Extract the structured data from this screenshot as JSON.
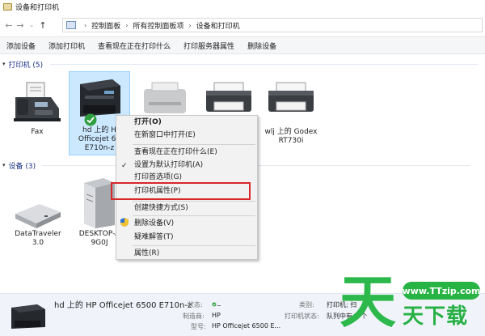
{
  "window": {
    "title": "设备和打印机"
  },
  "address": {
    "crumbs": [
      "控制面板",
      "所有控制面板项",
      "设备和打印机"
    ]
  },
  "toolbar": {
    "add_device": "添加设备",
    "add_printer": "添加打印机",
    "see_printing": "查看现在正在打印什么",
    "print_server": "打印服务器属性",
    "remove_device": "删除设备"
  },
  "printers_group": {
    "label": "打印机 (5)"
  },
  "devices_group": {
    "label": "设备 (3)"
  },
  "printers": [
    {
      "label": "Fax"
    },
    {
      "label": "hd 上的 HP Officejet 6500 E710n-z",
      "label_lines": [
        "hd 上的 H",
        "Officejet 65",
        "E710n-z"
      ]
    },
    {
      "label": ""
    },
    {
      "label": ""
    },
    {
      "label": "wlj 上的 Godex RT730i",
      "label_lines": [
        "wlj 上的 Godex",
        "RT730i"
      ]
    }
  ],
  "devices": [
    {
      "label_lines": [
        "DataTraveler",
        "3.0"
      ]
    },
    {
      "label_lines": [
        "DESKTOP-A",
        "9G0J"
      ]
    }
  ],
  "context_menu": {
    "items": [
      "打开(O)",
      "在新窗口中打开(E)",
      "查看现在正在打印什么(E)",
      "设置为默认打印机(A)",
      "打印首选项(G)",
      "打印机属性(P)",
      "创建快捷方式(S)",
      "删除设备(V)",
      "疑难解答(T)",
      "属性(R)"
    ],
    "checked_item": "设置为默认打印机(A)",
    "highlighted_item": "打印机属性(P)"
  },
  "details": {
    "title": "hd 上的 HP Officejet 6500 E710n-z",
    "status_label": "状态:",
    "manufacturer_label": "制造商:",
    "manufacturer_value": "HP",
    "model_label": "型号:",
    "model_value": "HP Officejet 6500 E...",
    "category_label": "类别:",
    "category_value": "打印机; 扫",
    "printer_status_label": "打印机状态:",
    "printer_status_value": "队列中有 0 个"
  },
  "watermark": {
    "pill": "www.TTzip.com",
    "text": "天下载"
  },
  "colors": {
    "selection": "#cce8ff",
    "highlight_box": "#d9262b",
    "group_header": "#1e3287",
    "watermark_green": "#2cb84a"
  }
}
